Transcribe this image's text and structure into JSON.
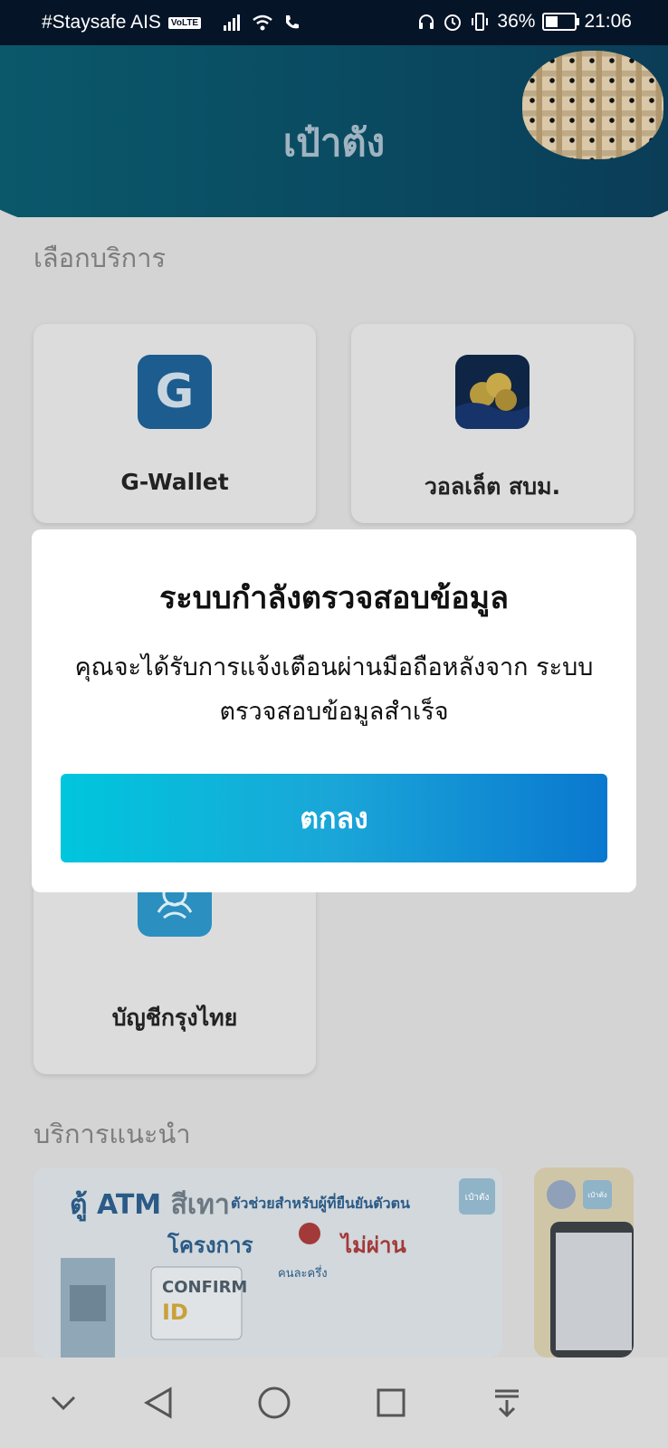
{
  "status_bar": {
    "carrier": "#Staysafe AIS",
    "volte": "VoLTE",
    "battery": "36%",
    "time": "21:06"
  },
  "header": {
    "title": "เป๋าตัง"
  },
  "services": {
    "section_title": "เลือกบริการ",
    "items": [
      {
        "label": "G-Wallet",
        "icon": "g-wallet-icon"
      },
      {
        "label": "วอลเล็ต สบม.",
        "icon": "bond-wallet-icon"
      },
      {
        "label": "บัญชีกรุงไทย",
        "icon": "krungthai-icon"
      }
    ]
  },
  "recommended": {
    "section_title": "บริการแนะนำ",
    "banner1": {
      "headline_prefix": "ตู้",
      "headline_atm": "ATM",
      "headline_color": "สีเทา",
      "tagline": "ตัวช่วยสำหรับผู้ที่ยืนยันตัวตน",
      "project": "โครงการ",
      "fail": "ไม่ผ่าน",
      "half": "คนละครึ่ง",
      "confirm": "CONFIRM",
      "id": "ID",
      "badge": "เป๋าตัง"
    },
    "banner2": {
      "badge": "เป๋าตัง"
    }
  },
  "modal": {
    "title": "ระบบกำลังตรวจสอบข้อมูล",
    "body": "คุณจะได้รับการแจ้งเตือนผ่านมือถือหลังจาก ระบบตรวจสอบข้อมูลสำเร็จ",
    "button": "ตกลง"
  },
  "colors": {
    "accent_start": "#00c6dc",
    "accent_end": "#0a78cf",
    "header": "#0a4a61"
  }
}
